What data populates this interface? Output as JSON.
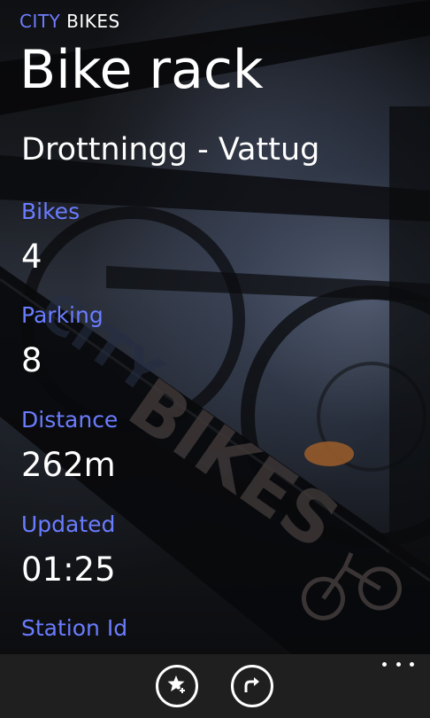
{
  "header": {
    "app_name_prefix": "CITY",
    "app_name_suffix": " BIKES",
    "page_title": "Bike rack",
    "station_name": "Drottningg - Vattug"
  },
  "details": [
    {
      "label": "Bikes",
      "value": "4"
    },
    {
      "label": "Parking",
      "value": "8"
    },
    {
      "label": "Distance",
      "value": "262m"
    },
    {
      "label": "Updated",
      "value": "01:25"
    },
    {
      "label": "Station Id",
      "value": ""
    }
  ],
  "background": {
    "frame_text": "BIKES",
    "frame_text_partial": "CITY"
  },
  "appbar": {
    "buttons": [
      {
        "name": "add-favorite",
        "icon": "star-add-icon"
      },
      {
        "name": "directions",
        "icon": "turn-arrow-icon"
      }
    ],
    "more_icon": "ellipsis-icon"
  },
  "colors": {
    "accent": "#6a7cff",
    "text": "#ffffff",
    "appbar_bg": "#1f1f1f"
  }
}
